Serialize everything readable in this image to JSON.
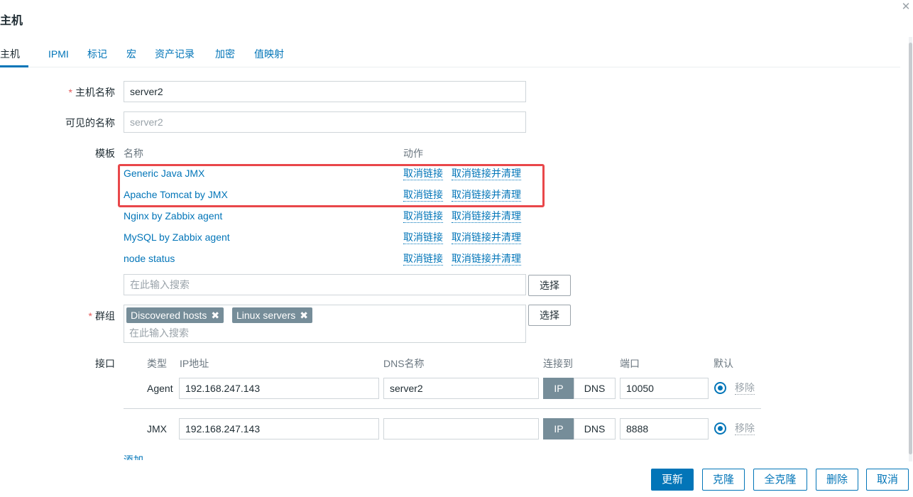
{
  "dialog": {
    "title": "主机",
    "close_symbol": "✕"
  },
  "tabs": [
    {
      "label": "主机",
      "active": true
    },
    {
      "label": "IPMI"
    },
    {
      "label": "标记"
    },
    {
      "label": "宏"
    },
    {
      "label": "资产记录"
    },
    {
      "label": "加密"
    },
    {
      "label": "值映射"
    }
  ],
  "form": {
    "host_name": {
      "label": "主机名称",
      "required_mark": "*",
      "value": "server2"
    },
    "visible_name": {
      "label": "可见的名称",
      "placeholder": "server2"
    },
    "templates": {
      "label": "模板",
      "col_name": "名称",
      "col_action": "动作",
      "unlink_label": "取消链接",
      "unlink_clear_label": "取消链接并清理",
      "items": [
        "Generic Java JMX",
        "Apache Tomcat by JMX",
        "Nginx by Zabbix agent",
        "MySQL by Zabbix agent",
        "node status"
      ],
      "search_placeholder": "在此输入搜索",
      "select_button": "选择"
    },
    "groups": {
      "label": "群组",
      "required_mark": "*",
      "tags": [
        "Discovered hosts",
        "Linux servers"
      ],
      "tag_remove_symbol": "✖",
      "search_placeholder": "在此输入搜索",
      "select_button": "选择"
    },
    "interfaces": {
      "label": "接口",
      "headers": {
        "type": "类型",
        "ip": "IP地址",
        "dns": "DNS名称",
        "connect": "连接到",
        "port": "端口",
        "default": "默认"
      },
      "connect_ip": "IP",
      "connect_dns": "DNS",
      "remove_label": "移除",
      "rows": [
        {
          "type": "Agent",
          "ip": "192.168.247.143",
          "dns": "server2",
          "port": "10050",
          "connect_to": "IP",
          "is_default": true
        },
        {
          "type": "JMX",
          "ip": "192.168.247.143",
          "dns": "",
          "port": "8888",
          "connect_to": "IP",
          "is_default": true
        }
      ],
      "add_label": "添加"
    }
  },
  "footer": {
    "update": "更新",
    "clone": "克隆",
    "full_clone": "全克隆",
    "delete": "删除",
    "cancel": "取消"
  },
  "colors": {
    "accent": "#0275b8",
    "highlight_border": "#e9474a",
    "tag_bg": "#768d99",
    "required": "#e45959"
  }
}
